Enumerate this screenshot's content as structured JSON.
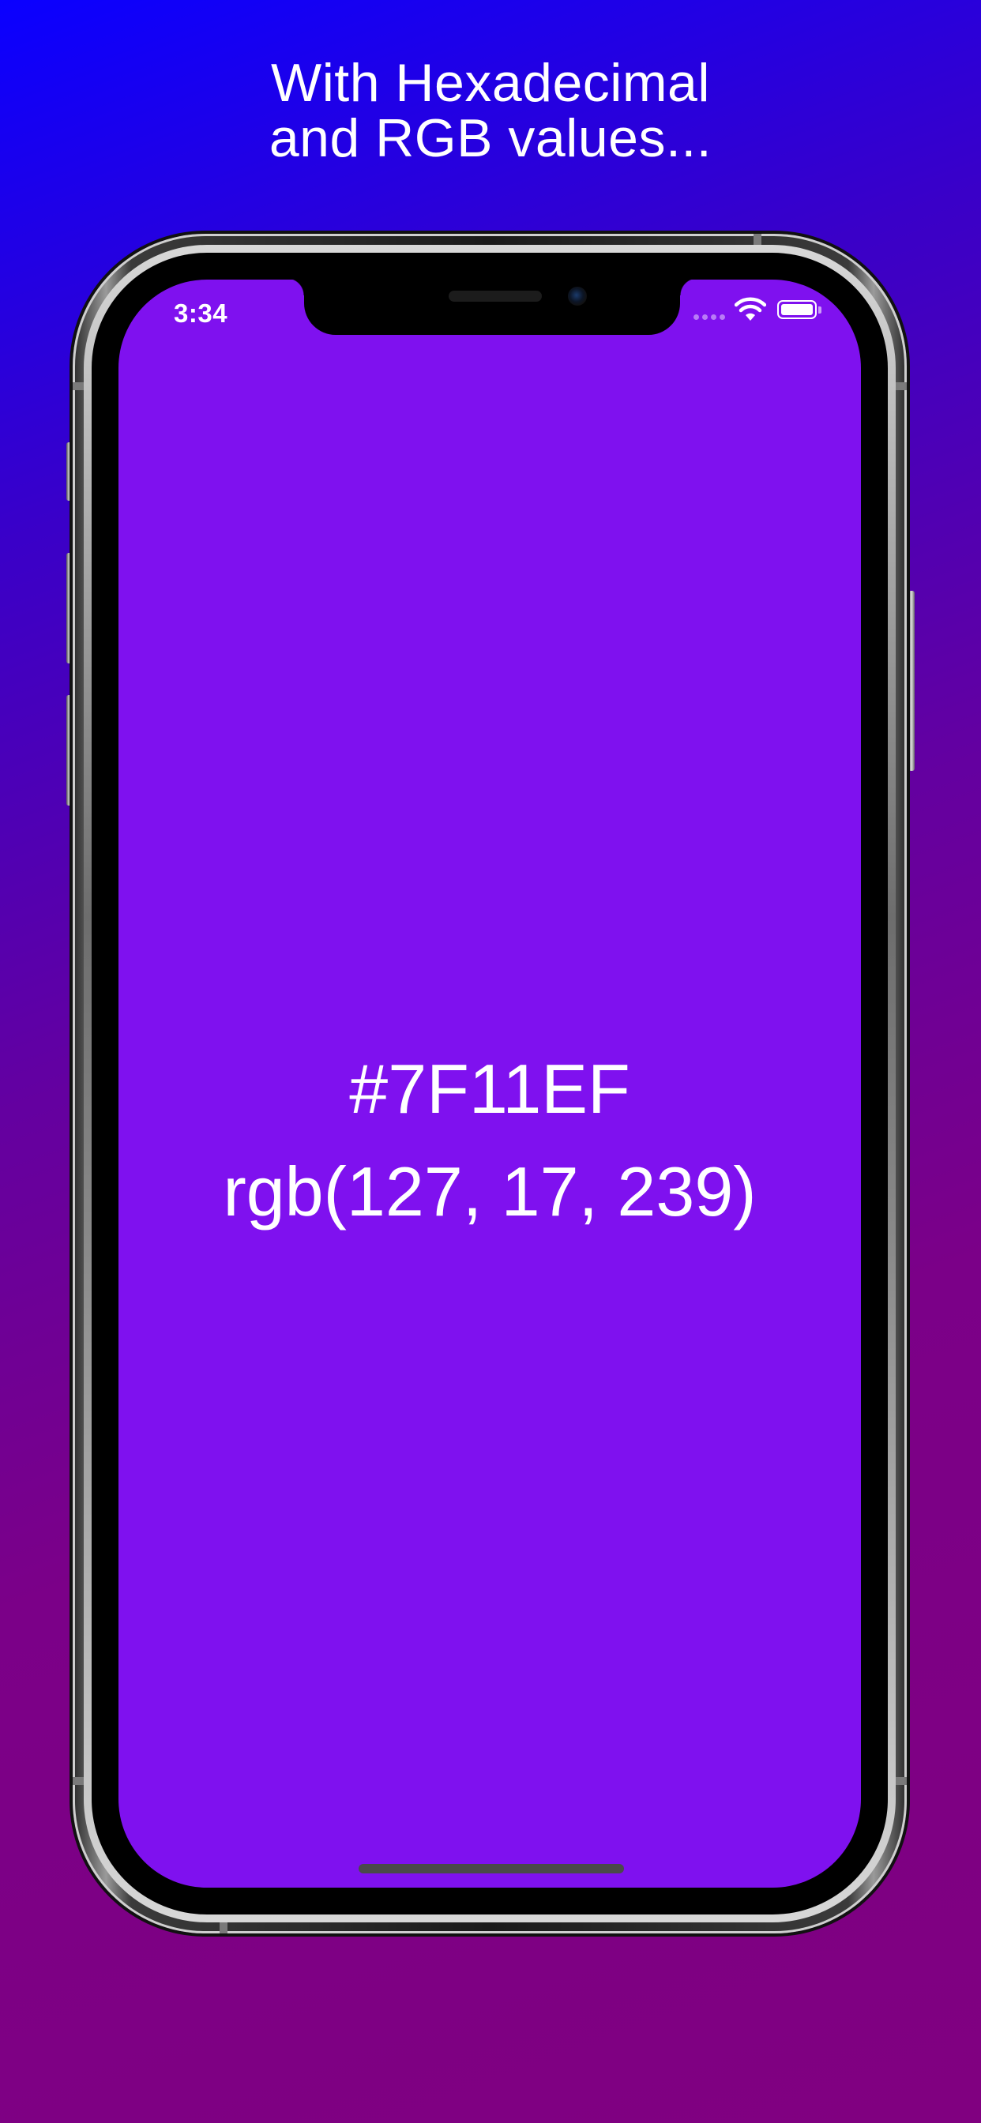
{
  "headline": {
    "line1": "With Hexadecimal",
    "line2": "and RGB values..."
  },
  "status_bar": {
    "time": "3:34",
    "icons": [
      "signal-dots-icon",
      "wifi-icon",
      "battery-icon"
    ]
  },
  "screen": {
    "background_color": "#7F11EF",
    "hex": "#7F11EF",
    "rgb": "rgb(127, 17, 239)"
  },
  "colors": {
    "gradient_start": "#0a00ff",
    "gradient_end": "#800080",
    "text": "#ffffff"
  }
}
